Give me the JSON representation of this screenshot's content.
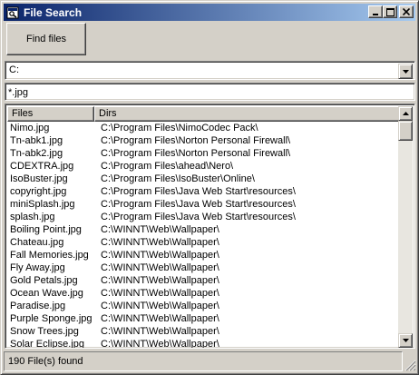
{
  "window": {
    "title": "File Search",
    "icon": "app-icon"
  },
  "caption_buttons": {
    "minimize": "minimize-icon",
    "maximize": "maximize-icon",
    "close": "close-icon"
  },
  "toolbar": {
    "find_label": "Find files"
  },
  "drive_combo": {
    "value": "C:"
  },
  "filter": {
    "value": "*.jpg"
  },
  "list": {
    "columns": [
      "Files",
      "Dirs"
    ],
    "rows": [
      {
        "file": "Nimo.jpg",
        "dir": "C:\\Program Files\\NimoCodec Pack\\"
      },
      {
        "file": "Tn-abk1.jpg",
        "dir": "C:\\Program Files\\Norton Personal Firewall\\"
      },
      {
        "file": "Tn-abk2.jpg",
        "dir": "C:\\Program Files\\Norton Personal Firewall\\"
      },
      {
        "file": "CDEXTRA.jpg",
        "dir": "C:\\Program Files\\ahead\\Nero\\"
      },
      {
        "file": "IsoBuster.jpg",
        "dir": "C:\\Program Files\\IsoBuster\\Online\\"
      },
      {
        "file": "copyright.jpg",
        "dir": "C:\\Program Files\\Java Web Start\\resources\\"
      },
      {
        "file": "miniSplash.jpg",
        "dir": "C:\\Program Files\\Java Web Start\\resources\\"
      },
      {
        "file": "splash.jpg",
        "dir": "C:\\Program Files\\Java Web Start\\resources\\"
      },
      {
        "file": "Boiling Point.jpg",
        "dir": "C:\\WINNT\\Web\\Wallpaper\\"
      },
      {
        "file": "Chateau.jpg",
        "dir": "C:\\WINNT\\Web\\Wallpaper\\"
      },
      {
        "file": "Fall Memories.jpg",
        "dir": "C:\\WINNT\\Web\\Wallpaper\\"
      },
      {
        "file": "Fly Away.jpg",
        "dir": "C:\\WINNT\\Web\\Wallpaper\\"
      },
      {
        "file": "Gold Petals.jpg",
        "dir": "C:\\WINNT\\Web\\Wallpaper\\"
      },
      {
        "file": "Ocean Wave.jpg",
        "dir": "C:\\WINNT\\Web\\Wallpaper\\"
      },
      {
        "file": "Paradise.jpg",
        "dir": "C:\\WINNT\\Web\\Wallpaper\\"
      },
      {
        "file": "Purple Sponge.jpg",
        "dir": "C:\\WINNT\\Web\\Wallpaper\\"
      },
      {
        "file": "Snow Trees.jpg",
        "dir": "C:\\WINNT\\Web\\Wallpaper\\"
      },
      {
        "file": "Solar Eclipse.jpg",
        "dir": "C:\\WINNT\\Web\\Wallpaper\\"
      }
    ]
  },
  "status": {
    "text": "190 File(s) found"
  },
  "colors": {
    "title_start": "#0a246a",
    "title_end": "#a6caf0",
    "face": "#d4d0c8"
  }
}
